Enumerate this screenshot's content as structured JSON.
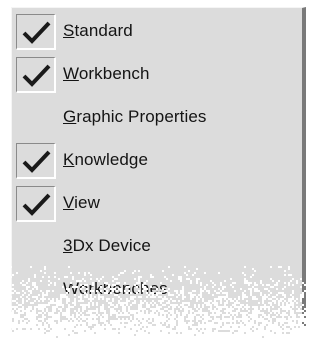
{
  "menu": {
    "items": [
      {
        "mnemonic": "S",
        "rest": "tandard",
        "checked": true
      },
      {
        "mnemonic": "W",
        "rest": "orkbench",
        "checked": true
      },
      {
        "mnemonic": "G",
        "rest": "raphic Properties",
        "checked": false
      },
      {
        "mnemonic": "K",
        "rest": "nowledge",
        "checked": true
      },
      {
        "mnemonic": "V",
        "rest": "iew",
        "checked": true
      },
      {
        "mnemonic": "3",
        "rest": "Dx Device",
        "checked": false
      },
      {
        "mnemonic": "",
        "rest": "Workbenches",
        "checked": false
      },
      {
        "mnemonic": "",
        "rest": "",
        "checked": false
      }
    ]
  },
  "icons": {
    "check": "check-mark-icon"
  },
  "colors": {
    "menu_background": "#dcdcdc",
    "check_mark": "#1a1a1a",
    "text": "#141414"
  }
}
